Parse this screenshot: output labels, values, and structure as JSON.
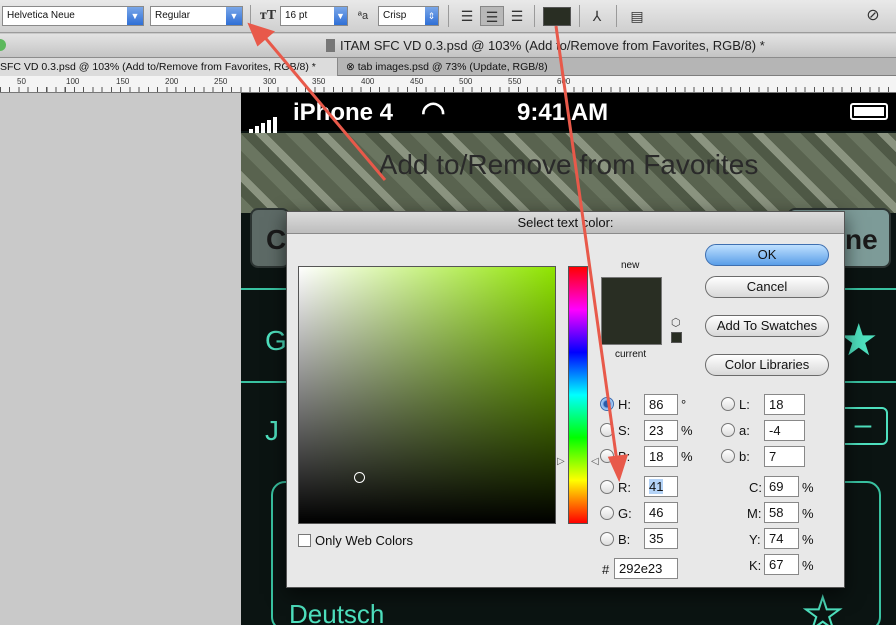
{
  "options_bar": {
    "font_family": "Helvetica Neue",
    "font_style": "Regular",
    "font_size": "16 pt",
    "aa_label": "a a",
    "antialias": "Crisp",
    "color_swatch": "#292e23"
  },
  "window": {
    "title": "ITAM SFC VD 0.3.psd @ 103% (Add to/Remove from Favorites, RGB/8) *"
  },
  "tabs": [
    {
      "label": "SFC VD 0.3.psd @ 103% (Add to/Remove from Favorites, RGB/8) *"
    },
    {
      "label": "tab images.psd @ 73% (Update, RGB/8)"
    }
  ],
  "ruler": {
    "ticks": [
      "50",
      "100",
      "150",
      "200",
      "250",
      "300",
      "350",
      "400",
      "450",
      "500",
      "550",
      "600"
    ]
  },
  "canvas": {
    "carrier": "iPhone 4",
    "time": "9:41 AM",
    "nav_title": "Add to/Remove from Favorites",
    "left_button_partial": "C",
    "right_button_partial": "ne",
    "row1_partial": "G",
    "row2_partial": "J",
    "row_last": "Deutsch"
  },
  "dialog": {
    "title": "Select text color:",
    "new_label": "new",
    "current_label": "current",
    "buttons": {
      "ok": "OK",
      "cancel": "Cancel",
      "add_swatches": "Add To Swatches",
      "color_libraries": "Color Libraries"
    },
    "only_web_colors": "Only Web Colors",
    "hsb": {
      "H": "86",
      "S": "23",
      "B": "18",
      "H_unit": "°",
      "S_unit": "%",
      "B_unit": "%"
    },
    "lab": {
      "L": "18",
      "a": "-4",
      "b": "7"
    },
    "rgb": {
      "R": "41",
      "G": "46",
      "B": "35"
    },
    "cmyk": {
      "C": "69",
      "M": "58",
      "Y": "74",
      "K": "67",
      "unit": "%"
    },
    "hex_label": "#",
    "hex": "292e23",
    "labels": {
      "H": "H:",
      "S": "S:",
      "B": "B:",
      "R": "R:",
      "G": "G:",
      "Bl": "B:",
      "L": "L:",
      "a": "a:",
      "b": "b:",
      "C": "C:",
      "M": "M:",
      "Y": "Y:",
      "K": "K:"
    }
  },
  "colors": {
    "selected": "#292e23",
    "arrow": "#e8594a",
    "accent_green": "#4ee0be"
  }
}
